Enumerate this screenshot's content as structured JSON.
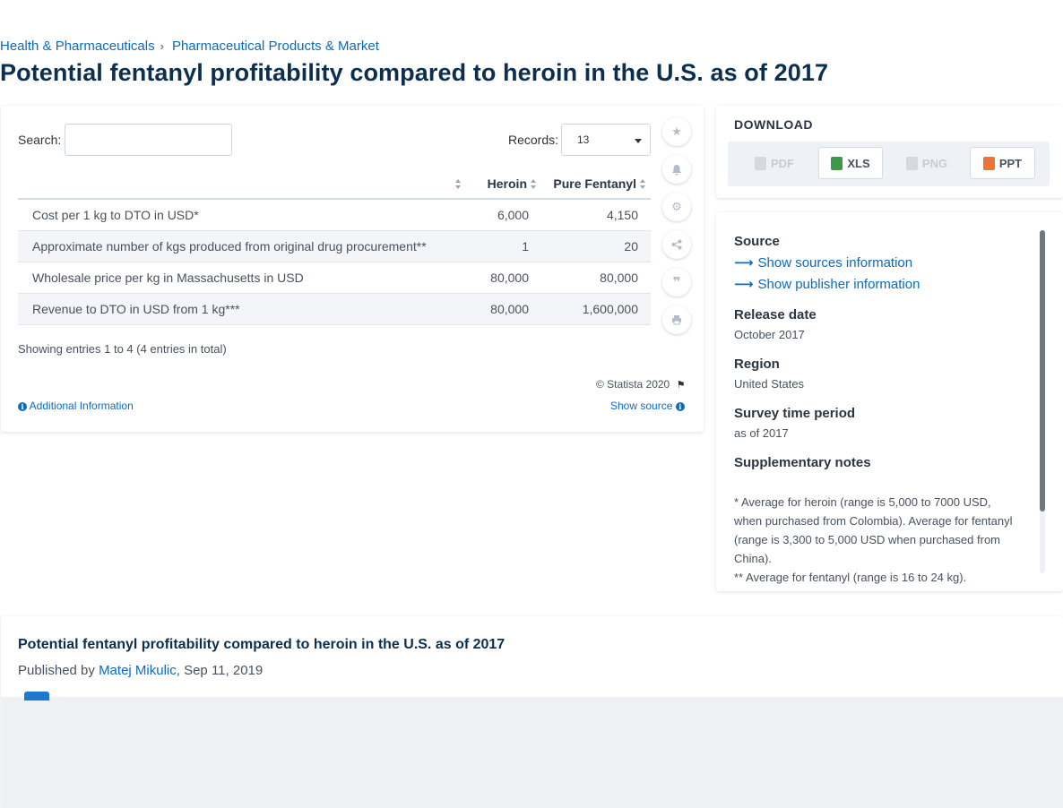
{
  "breadcrumb": {
    "items": [
      "Health & Pharmaceuticals",
      "Pharmaceutical Products & Market"
    ],
    "separator": "›"
  },
  "page_title": "Potential fentanyl profitability compared to heroin in the U.S. as of 2017",
  "table_controls": {
    "search_label": "Search:",
    "search_value": "",
    "records_label": "Records:",
    "records_value": "13"
  },
  "table": {
    "columns": [
      "",
      "Heroin",
      "Pure Fentanyl"
    ],
    "rows": [
      {
        "label": "Cost per 1 kg to DTO in USD*",
        "heroin": "6,000",
        "fentanyl": "4,150"
      },
      {
        "label": "Approximate number of kgs produced from original drug procurement**",
        "heroin": "1",
        "fentanyl": "20"
      },
      {
        "label": "Wholesale price per kg in Massachusetts in USD",
        "heroin": "80,000",
        "fentanyl": "80,000"
      },
      {
        "label": "Revenue to DTO in USD from 1 kg***",
        "heroin": "80,000",
        "fentanyl": "1,600,000"
      }
    ]
  },
  "entries_info": "Showing entries 1 to 4 (4 entries in total)",
  "copyright": "© Statista 2020",
  "additional_info": "Additional Information",
  "show_source": "Show source",
  "side_tools": [
    "star-icon",
    "bell-icon",
    "gear-icon",
    "share-icon",
    "quote-icon",
    "print-icon"
  ],
  "download": {
    "title": "DOWNLOAD",
    "buttons": [
      {
        "label": "PDF",
        "enabled": false
      },
      {
        "label": "XLS",
        "enabled": true
      },
      {
        "label": "PNG",
        "enabled": false
      },
      {
        "label": "PPT",
        "enabled": true
      }
    ]
  },
  "details": {
    "source_heading": "Source",
    "show_sources": "Show sources information",
    "show_publisher": "Show publisher information",
    "release_heading": "Release date",
    "release_value": "October 2017",
    "region_heading": "Region",
    "region_value": "United States",
    "survey_heading": "Survey time period",
    "survey_value": "as of 2017",
    "notes_heading": "Supplementary notes",
    "notes_text": "* Average for heroin (range is 5,000 to 7000 USD, when purchased from Colombia). Average for fentanyl (range is 3,300 to 5,000 USD when purchased from China).",
    "notes_text_2": "** Average for fentanyl (range is 16 to 24 kg)."
  },
  "lower": {
    "title": "Potential fentanyl profitability compared to heroin in the U.S. as of 2017",
    "published_prefix": "Published by ",
    "author": "Matej Mikulic",
    "date": ", Sep 11, 2019"
  },
  "colors": {
    "link": "#0b6bc0",
    "title": "#0d2f4f",
    "xls": "#3a9a4b",
    "ppt": "#e8763a"
  }
}
